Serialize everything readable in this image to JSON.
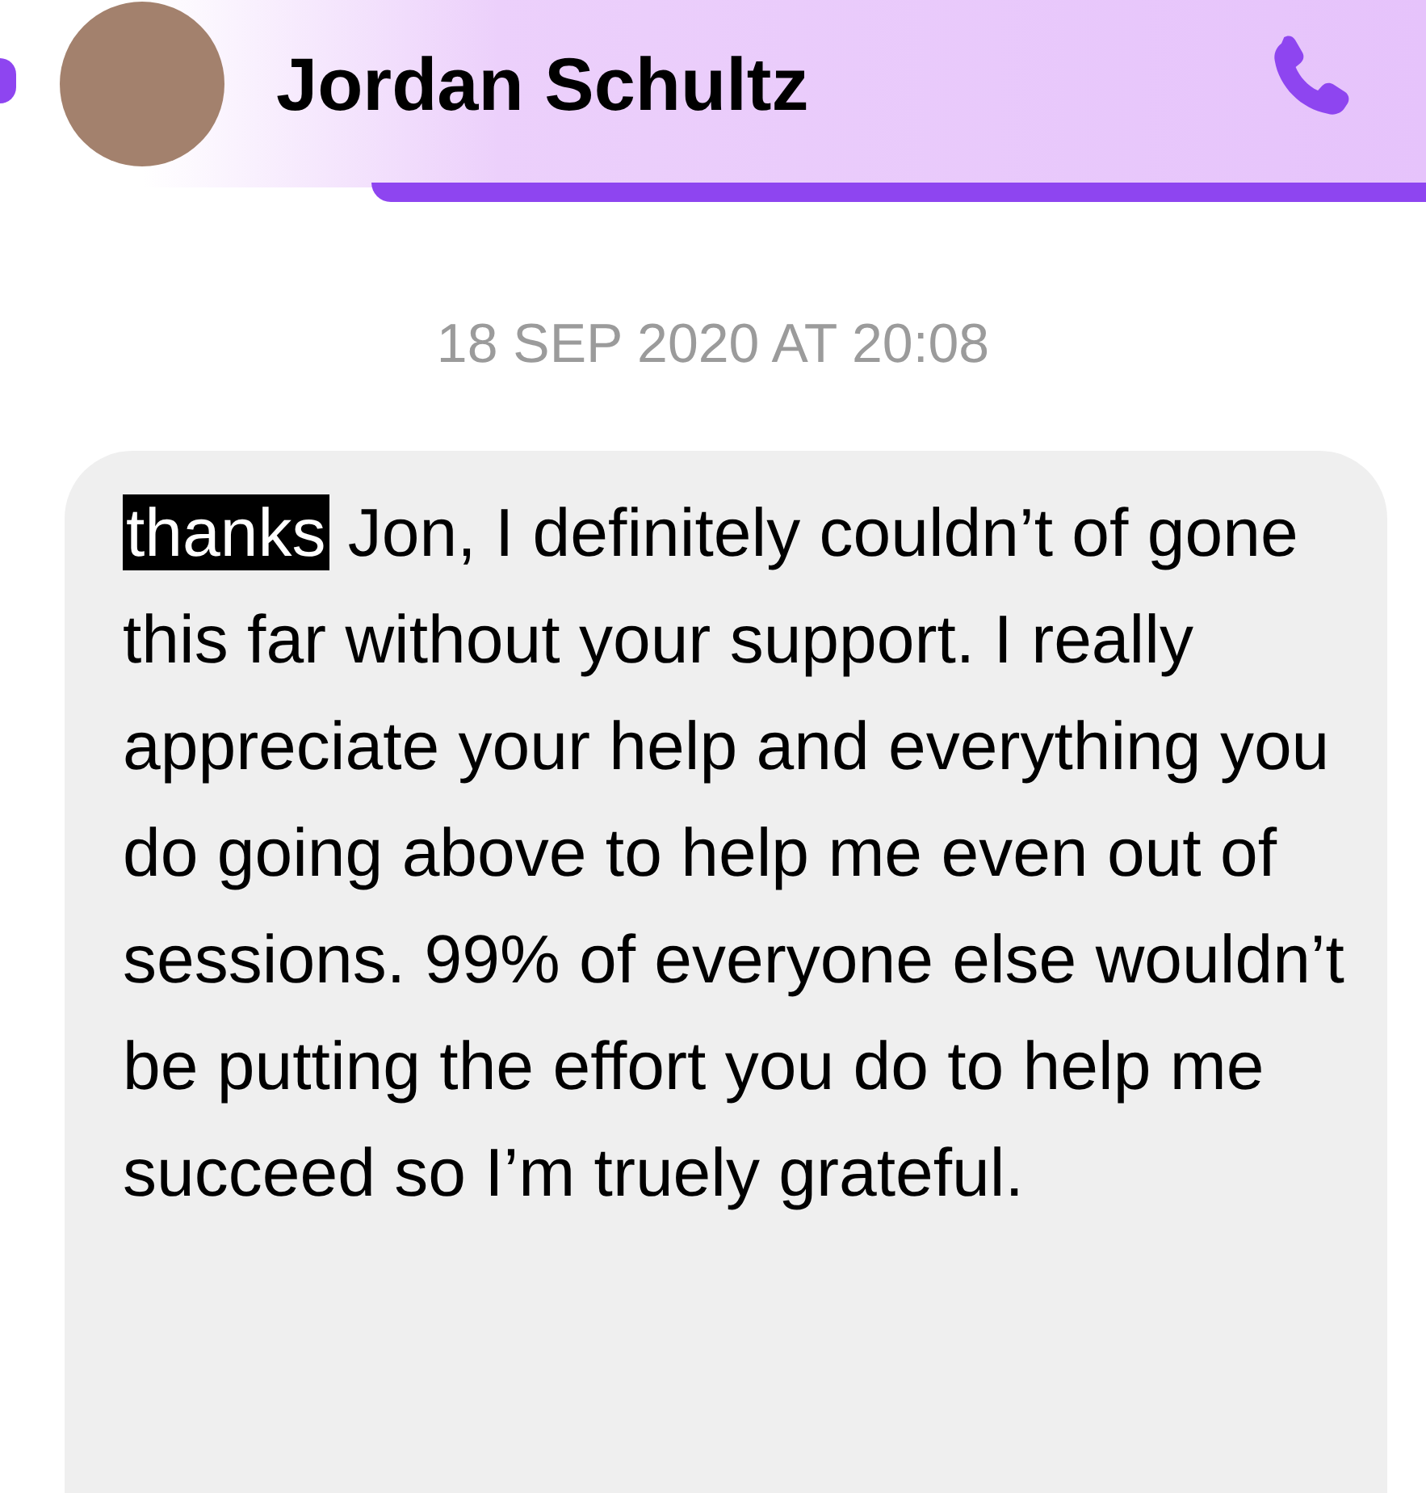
{
  "header": {
    "name": "Jordan Schultz"
  },
  "timestamp": "18 SEP 2020 AT 20:08",
  "message": {
    "selection": "thanks",
    "text": " Jon, I definitely couldn’t of gone this far without your support. I really appreciate your help and everything you do going above to help me even out of sessions. 99% of everyone else wouldn’t be putting the effort you do to help me succeed so I’m truely grateful."
  }
}
